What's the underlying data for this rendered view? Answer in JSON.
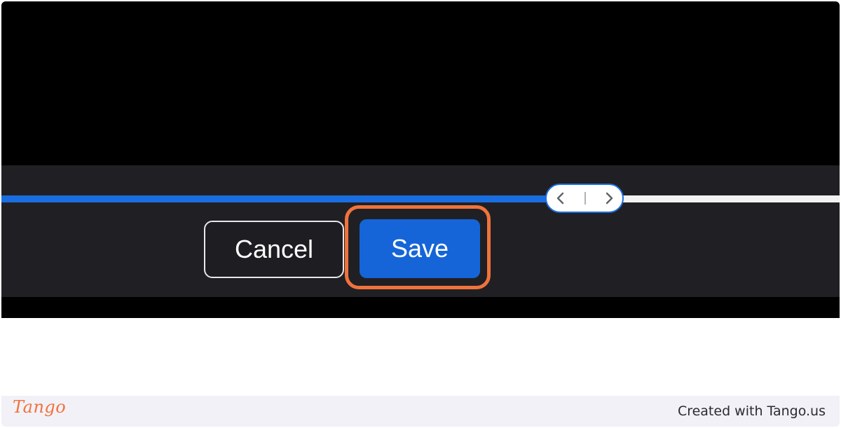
{
  "editor": {
    "timeline_progress_percent": 66,
    "trim_handle_icons": [
      "chevron-left-icon",
      "divider-icon",
      "chevron-right-icon"
    ],
    "cancel_label": "Cancel",
    "save_label": "Save"
  },
  "footer": {
    "brand": "Tango",
    "credit": "Created with Tango.us"
  },
  "colors": {
    "accent_blue": "#1565d8",
    "highlight_orange": "#f0733c",
    "toolbar_bg": "#202024"
  }
}
